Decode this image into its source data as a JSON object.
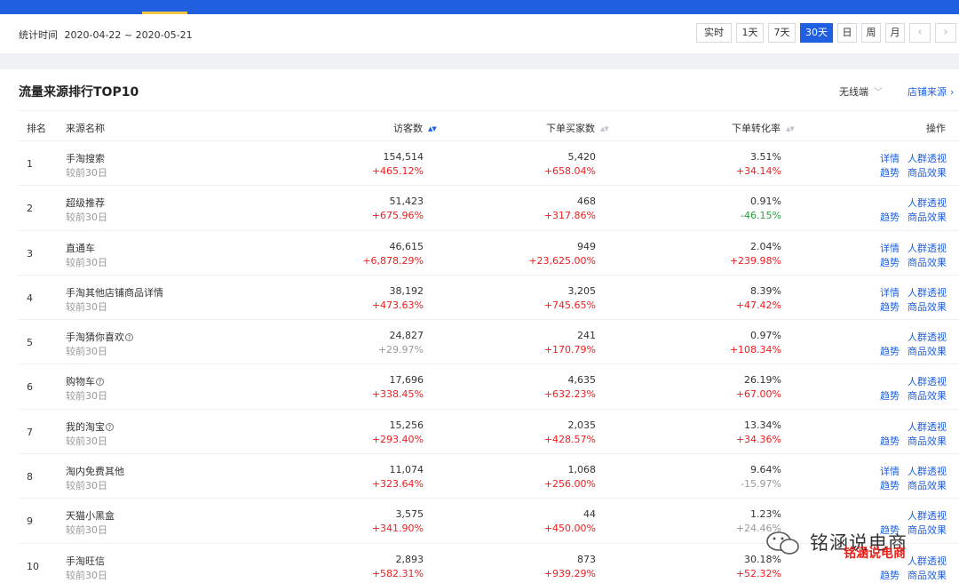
{
  "date_bar": {
    "label": "统计时间",
    "range": "2020-04-22 ~ 2020-05-21",
    "buttons": [
      "实时",
      "1天",
      "7天",
      "30天",
      "日",
      "周",
      "月"
    ],
    "active_button": "30天",
    "prev": "‹",
    "next": "›"
  },
  "panel": {
    "title": "流量来源排行TOP10",
    "device_select": "无线端",
    "shop_source": "店铺来源",
    "columns": {
      "rank": "排名",
      "source": "来源名称",
      "visitors": "访客数",
      "buyers": "下单买家数",
      "rate": "下单转化率",
      "action": "操作"
    }
  },
  "rows": [
    {
      "rank": "1",
      "name": "手淘搜索",
      "help": false,
      "compare": "较前30日",
      "visitors": "154,514",
      "visitors_pct": "+465.12%",
      "buyers": "5,420",
      "buyers_pct": "+658.04%",
      "rate": "3.51%",
      "rate_pct": "+34.14%",
      "rate_dir": "up",
      "detail": "详情",
      "crowd": "人群透视",
      "trend": "趋势",
      "goods": "商品效果"
    },
    {
      "rank": "2",
      "name": "超级推荐",
      "help": false,
      "compare": "较前30日",
      "visitors": "51,423",
      "visitors_pct": "+675.96%",
      "buyers": "468",
      "buyers_pct": "+317.86%",
      "rate": "0.91%",
      "rate_pct": "-46.15%",
      "rate_dir": "down",
      "detail": "",
      "crowd": "人群透视",
      "trend": "趋势",
      "goods": "商品效果"
    },
    {
      "rank": "3",
      "name": "直通车",
      "help": false,
      "compare": "较前30日",
      "visitors": "46,615",
      "visitors_pct": "+6,878.29%",
      "buyers": "949",
      "buyers_pct": "+23,625.00%",
      "rate": "2.04%",
      "rate_pct": "+239.98%",
      "rate_dir": "up",
      "detail": "详情",
      "crowd": "人群透视",
      "trend": "趋势",
      "goods": "商品效果"
    },
    {
      "rank": "4",
      "name": "手淘其他店铺商品详情",
      "help": false,
      "compare": "较前30日",
      "visitors": "38,192",
      "visitors_pct": "+473.63%",
      "buyers": "3,205",
      "buyers_pct": "+745.65%",
      "rate": "8.39%",
      "rate_pct": "+47.42%",
      "rate_dir": "up",
      "detail": "详情",
      "crowd": "人群透视",
      "trend": "趋势",
      "goods": "商品效果"
    },
    {
      "rank": "5",
      "name": "手淘猜你喜欢",
      "help": true,
      "compare": "较前30日",
      "visitors": "24,827",
      "visitors_pct": "+29.97%",
      "visitors_dir": "neutral",
      "buyers": "241",
      "buyers_pct": "+170.79%",
      "rate": "0.97%",
      "rate_pct": "+108.34%",
      "rate_dir": "up",
      "detail": "",
      "crowd": "人群透视",
      "trend": "趋势",
      "goods": "商品效果"
    },
    {
      "rank": "6",
      "name": "购物车",
      "help": true,
      "compare": "较前30日",
      "visitors": "17,696",
      "visitors_pct": "+338.45%",
      "buyers": "4,635",
      "buyers_pct": "+632.23%",
      "rate": "26.19%",
      "rate_pct": "+67.00%",
      "rate_dir": "up",
      "detail": "",
      "crowd": "人群透视",
      "trend": "趋势",
      "goods": "商品效果"
    },
    {
      "rank": "7",
      "name": "我的淘宝",
      "help": true,
      "compare": "较前30日",
      "visitors": "15,256",
      "visitors_pct": "+293.40%",
      "buyers": "2,035",
      "buyers_pct": "+428.57%",
      "rate": "13.34%",
      "rate_pct": "+34.36%",
      "rate_dir": "up",
      "detail": "",
      "crowd": "人群透视",
      "trend": "趋势",
      "goods": "商品效果"
    },
    {
      "rank": "8",
      "name": "淘内免费其他",
      "help": false,
      "compare": "较前30日",
      "visitors": "11,074",
      "visitors_pct": "+323.64%",
      "buyers": "1,068",
      "buyers_pct": "+256.00%",
      "rate": "9.64%",
      "rate_pct": "-15.97%",
      "rate_dir": "neutral",
      "detail": "详情",
      "crowd": "人群透视",
      "trend": "趋势",
      "goods": "商品效果"
    },
    {
      "rank": "9",
      "name": "天猫小黑盒",
      "help": false,
      "compare": "较前30日",
      "visitors": "3,575",
      "visitors_pct": "+341.90%",
      "buyers": "44",
      "buyers_pct": "+450.00%",
      "rate": "1.23%",
      "rate_pct": "+24.46%",
      "rate_dir": "neutral",
      "detail": "",
      "crowd": "人群透视",
      "trend": "趋势",
      "goods": "商品效果"
    },
    {
      "rank": "10",
      "name": "手淘旺信",
      "help": false,
      "compare": "较前30日",
      "visitors": "2,893",
      "visitors_pct": "+582.31%",
      "buyers": "873",
      "buyers_pct": "+939.29%",
      "rate": "30.18%",
      "rate_pct": "+52.32%",
      "rate_dir": "up",
      "detail": "",
      "crowd": "人群透视",
      "trend": "趋势",
      "goods": "商品效果"
    }
  ],
  "watermark": {
    "text": "铭涵说电商",
    "red_text": "铭涵说电商"
  },
  "colors": {
    "accent": "#1f5fe0",
    "up": "#f01d1d",
    "down": "#2e9c3f",
    "tab_indicator": "#f5c542"
  }
}
